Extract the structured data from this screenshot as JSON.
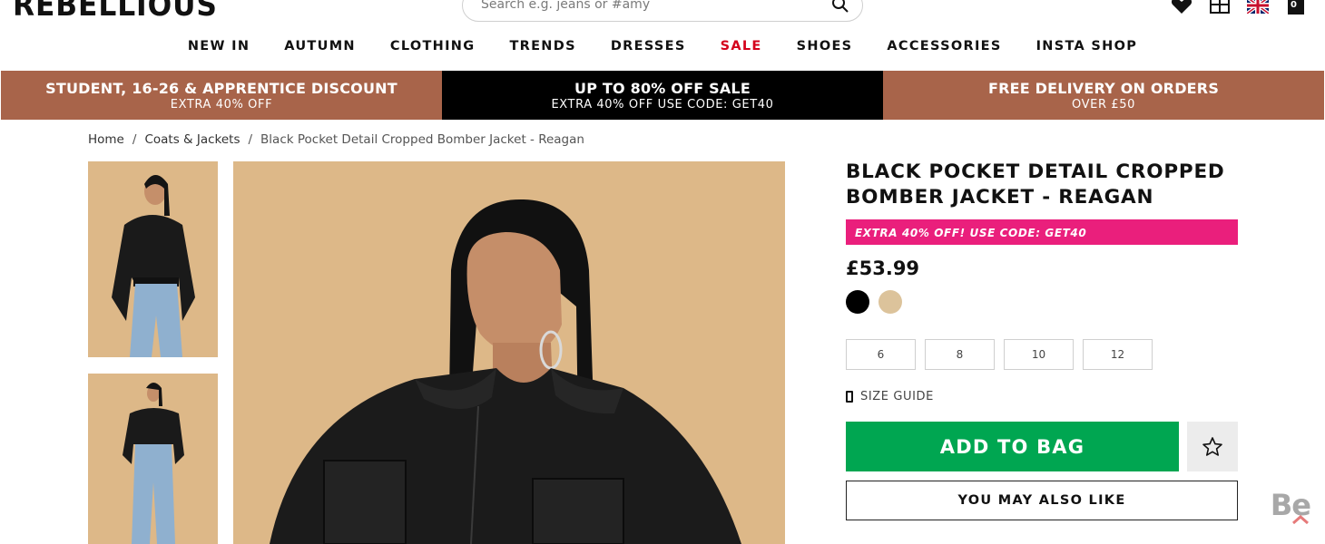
{
  "header": {
    "logo": "REBELLIOUS",
    "search_placeholder": "Search e.g. jeans or #amy",
    "bag_count": "0"
  },
  "nav": [
    {
      "label": "NEW IN",
      "name": "nav-new-in"
    },
    {
      "label": "AUTUMN",
      "name": "nav-autumn"
    },
    {
      "label": "CLOTHING",
      "name": "nav-clothing"
    },
    {
      "label": "TRENDS",
      "name": "nav-trends"
    },
    {
      "label": "DRESSES",
      "name": "nav-dresses"
    },
    {
      "label": "SALE",
      "name": "nav-sale"
    },
    {
      "label": "SHOES",
      "name": "nav-shoes"
    },
    {
      "label": "ACCESSORIES",
      "name": "nav-accessories"
    },
    {
      "label": "INSTA SHOP",
      "name": "nav-insta-shop"
    }
  ],
  "promo": [
    {
      "title": "STUDENT, 16-26 & APPRENTICE DISCOUNT",
      "sub": "EXTRA 40% OFF"
    },
    {
      "title": "UP TO 80% OFF SALE",
      "sub": "EXTRA 40% OFF USE CODE: GET40"
    },
    {
      "title": "FREE DELIVERY ON ORDERS",
      "sub": "OVER £50"
    }
  ],
  "breadcrumb": {
    "home": "Home",
    "category": "Coats & Jackets",
    "current": "Black Pocket Detail Cropped Bomber Jacket - Reagan",
    "separator": "/"
  },
  "product": {
    "title_line1": "BLACK POCKET DETAIL CROPPED",
    "title_line2": "BOMBER JACKET - REAGAN",
    "code_banner": "EXTRA 40% OFF! USE CODE: GET40",
    "price": "£53.99",
    "swatch_colors": [
      "#000000",
      "#dcc39b"
    ],
    "sizes": [
      "6",
      "8",
      "10",
      "12"
    ],
    "size_guide": "SIZE GUIDE",
    "add_to_bag": "ADD TO BAG",
    "you_may_also_like": "YOU MAY ALSO LIKE"
  },
  "colors": {
    "promo_brown": "#a8644a",
    "add_green": "#00a651",
    "code_pink": "#ea1f7c",
    "sale_red": "#d4001b",
    "image_bg": "#ddb888"
  },
  "watermark": "Be"
}
